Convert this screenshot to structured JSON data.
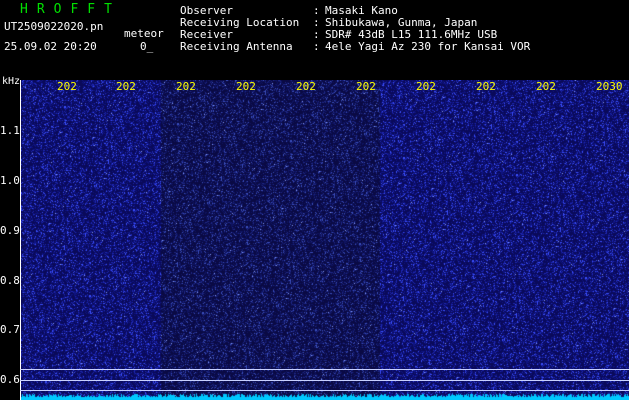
{
  "header": {
    "app_title": "HROFFT",
    "filename": "UT2509022020.pn",
    "mode": "meteor",
    "timestamp": "25.09.02 20:20",
    "counter": "0_",
    "meta": [
      {
        "key": "Observer",
        "value": "Masaki Kano"
      },
      {
        "key": "Receiving Location",
        "value": "Shibukawa, Gunma, Japan"
      },
      {
        "key": "Receiver",
        "value": "SDR# 43dB L15 111.6MHz USB"
      },
      {
        "key": "Receiving Antenna",
        "value": "4ele Yagi Az 230 for Kansai VOR"
      }
    ],
    "separator": ":"
  },
  "spectrogram": {
    "y_unit": "kHz",
    "y_labels": [
      "1.1",
      "1.0",
      "0.9",
      "0.8",
      "0.7",
      "0.6"
    ],
    "x_labels": [
      "202",
      "202",
      "202",
      "202",
      "202",
      "202",
      "202",
      "202",
      "202",
      "2030"
    ],
    "colors": {
      "background": "#0a0a6a",
      "noise": "#3a48ff",
      "baseline": "#00c8ff",
      "label": "#ffff00"
    }
  }
}
